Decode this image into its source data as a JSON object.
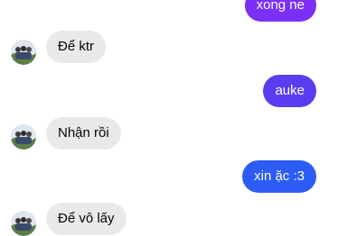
{
  "colors": {
    "incoming_bg": "#e9e9eb",
    "outgoing_top": "#7b2ff7",
    "outgoing_mid": "#5b3cf0",
    "outgoing_bottom": "#2d5cf5"
  },
  "messages": [
    {
      "direction": "outgoing",
      "text": "xong ne"
    },
    {
      "direction": "incoming",
      "text": "Để ktr"
    },
    {
      "direction": "outgoing",
      "text": "auke"
    },
    {
      "direction": "incoming",
      "text": "Nhận rồi"
    },
    {
      "direction": "outgoing",
      "text": "xin ặc :3"
    },
    {
      "direction": "incoming",
      "text": "Để vô lấy"
    }
  ]
}
